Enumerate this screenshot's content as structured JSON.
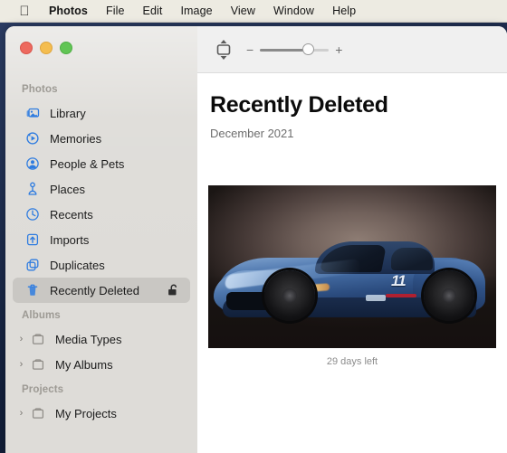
{
  "menubar": {
    "apple_icon": "apple-logo-icon",
    "items": [
      {
        "label": "Photos",
        "bold": true
      },
      {
        "label": "File",
        "bold": false
      },
      {
        "label": "Edit",
        "bold": false
      },
      {
        "label": "Image",
        "bold": false
      },
      {
        "label": "View",
        "bold": false
      },
      {
        "label": "Window",
        "bold": false
      },
      {
        "label": "Help",
        "bold": false
      }
    ]
  },
  "window": {
    "traffic_lights": {
      "close": "close-button",
      "minimize": "minimize-button",
      "maximize": "maximize-button"
    }
  },
  "toolbar": {
    "aspect_icon": "aspect-ratio-icon",
    "zoom_out_label": "−",
    "zoom_in_label": "+",
    "zoom_value": 62
  },
  "sidebar": {
    "sections": [
      {
        "title": "Photos",
        "items": [
          {
            "label": "Library",
            "icon": "photo-stack-icon",
            "selected": false,
            "expandable": false
          },
          {
            "label": "Memories",
            "icon": "memories-icon",
            "selected": false,
            "expandable": false
          },
          {
            "label": "People & Pets",
            "icon": "people-icon",
            "selected": false,
            "expandable": false
          },
          {
            "label": "Places",
            "icon": "map-pin-icon",
            "selected": false,
            "expandable": false
          },
          {
            "label": "Recents",
            "icon": "clock-icon",
            "selected": false,
            "expandable": false
          },
          {
            "label": "Imports",
            "icon": "import-icon",
            "selected": false,
            "expandable": false
          },
          {
            "label": "Duplicates",
            "icon": "duplicates-icon",
            "selected": false,
            "expandable": false
          },
          {
            "label": "Recently Deleted",
            "icon": "trash-icon",
            "selected": true,
            "expandable": false,
            "accessory": "unlocked-padlock-icon"
          }
        ]
      },
      {
        "title": "Albums",
        "items": [
          {
            "label": "Media Types",
            "icon": "album-folder-icon",
            "selected": false,
            "expandable": true
          },
          {
            "label": "My Albums",
            "icon": "album-folder-icon",
            "selected": false,
            "expandable": true
          }
        ]
      },
      {
        "title": "Projects",
        "items": [
          {
            "label": "My Projects",
            "icon": "album-folder-icon",
            "selected": false,
            "expandable": true
          }
        ]
      }
    ]
  },
  "main": {
    "title": "Recently Deleted",
    "subtitle": "December 2021",
    "photos": [
      {
        "name": "blue-sports-car-photo",
        "caption": "29 days left",
        "decal_number": "11"
      }
    ]
  },
  "colors": {
    "menubar_bg": "#edebe2",
    "sidebar_bg": "#dedcd8",
    "selected_row_bg": "#c9c7c3",
    "toolbar_bg": "#f0f0f0",
    "content_bg": "#ffffff",
    "icon_blue": "#2f7ce0",
    "section_header": "#9d9a94",
    "caption_grey": "#8c8c8c",
    "traffic_red": "#ed6a5f",
    "traffic_yellow": "#f4bd4f",
    "traffic_green": "#61c554"
  }
}
